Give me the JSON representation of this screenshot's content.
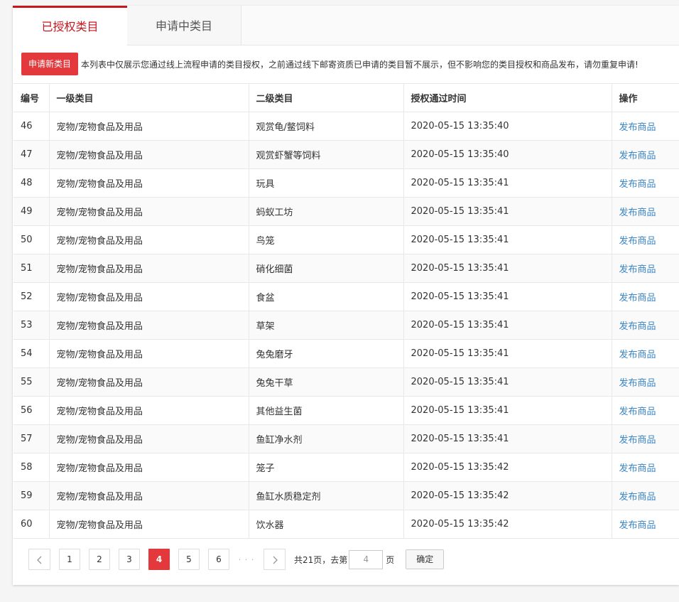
{
  "tabs": [
    {
      "label": "已授权类目",
      "active": true
    },
    {
      "label": "申请中类目",
      "active": false
    }
  ],
  "notice": {
    "button_label": "申请新类目",
    "text": "本列表中仅展示您通过线上流程申请的类目授权，之前通过线下邮寄资质已申请的类目暂不展示，但不影响您的类目授权和商品发布，请勿重复申请!"
  },
  "table": {
    "headers": [
      "编号",
      "一级类目",
      "二级类目",
      "授权通过时间",
      "操作"
    ],
    "rows": [
      {
        "id": "46",
        "cat1": "宠物/宠物食品及用品",
        "cat2": "观赏龟/鳖饲料",
        "time": "2020-05-15 13:35:40",
        "action": "发布商品"
      },
      {
        "id": "47",
        "cat1": "宠物/宠物食品及用品",
        "cat2": "观赏虾蟹等饲料",
        "time": "2020-05-15 13:35:40",
        "action": "发布商品"
      },
      {
        "id": "48",
        "cat1": "宠物/宠物食品及用品",
        "cat2": "玩具",
        "time": "2020-05-15 13:35:41",
        "action": "发布商品"
      },
      {
        "id": "49",
        "cat1": "宠物/宠物食品及用品",
        "cat2": "蚂蚁工坊",
        "time": "2020-05-15 13:35:41",
        "action": "发布商品"
      },
      {
        "id": "50",
        "cat1": "宠物/宠物食品及用品",
        "cat2": "鸟笼",
        "time": "2020-05-15 13:35:41",
        "action": "发布商品"
      },
      {
        "id": "51",
        "cat1": "宠物/宠物食品及用品",
        "cat2": "硝化细菌",
        "time": "2020-05-15 13:35:41",
        "action": "发布商品"
      },
      {
        "id": "52",
        "cat1": "宠物/宠物食品及用品",
        "cat2": "食盆",
        "time": "2020-05-15 13:35:41",
        "action": "发布商品"
      },
      {
        "id": "53",
        "cat1": "宠物/宠物食品及用品",
        "cat2": "草架",
        "time": "2020-05-15 13:35:41",
        "action": "发布商品"
      },
      {
        "id": "54",
        "cat1": "宠物/宠物食品及用品",
        "cat2": "兔兔磨牙",
        "time": "2020-05-15 13:35:41",
        "action": "发布商品"
      },
      {
        "id": "55",
        "cat1": "宠物/宠物食品及用品",
        "cat2": "兔兔干草",
        "time": "2020-05-15 13:35:41",
        "action": "发布商品"
      },
      {
        "id": "56",
        "cat1": "宠物/宠物食品及用品",
        "cat2": "其他益生菌",
        "time": "2020-05-15 13:35:41",
        "action": "发布商品"
      },
      {
        "id": "57",
        "cat1": "宠物/宠物食品及用品",
        "cat2": "鱼缸净水剂",
        "time": "2020-05-15 13:35:41",
        "action": "发布商品"
      },
      {
        "id": "58",
        "cat1": "宠物/宠物食品及用品",
        "cat2": "笼子",
        "time": "2020-05-15 13:35:42",
        "action": "发布商品"
      },
      {
        "id": "59",
        "cat1": "宠物/宠物食品及用品",
        "cat2": "鱼缸水质稳定剂",
        "time": "2020-05-15 13:35:42",
        "action": "发布商品"
      },
      {
        "id": "60",
        "cat1": "宠物/宠物食品及用品",
        "cat2": "饮水器",
        "time": "2020-05-15 13:35:42",
        "action": "发布商品"
      }
    ]
  },
  "pager": {
    "prev_icon": "chevron-left-icon",
    "next_icon": "chevron-right-icon",
    "pages": [
      "1",
      "2",
      "3",
      "4",
      "5",
      "6"
    ],
    "current": "4",
    "ellipsis": "· · ·",
    "total_text": "共21页，去第",
    "goto_value": "4",
    "suffix": "页",
    "confirm_label": "确定"
  },
  "colors": {
    "accent": "#e3393c",
    "tab_active": "#c8161d",
    "link": "#3a85c6"
  }
}
